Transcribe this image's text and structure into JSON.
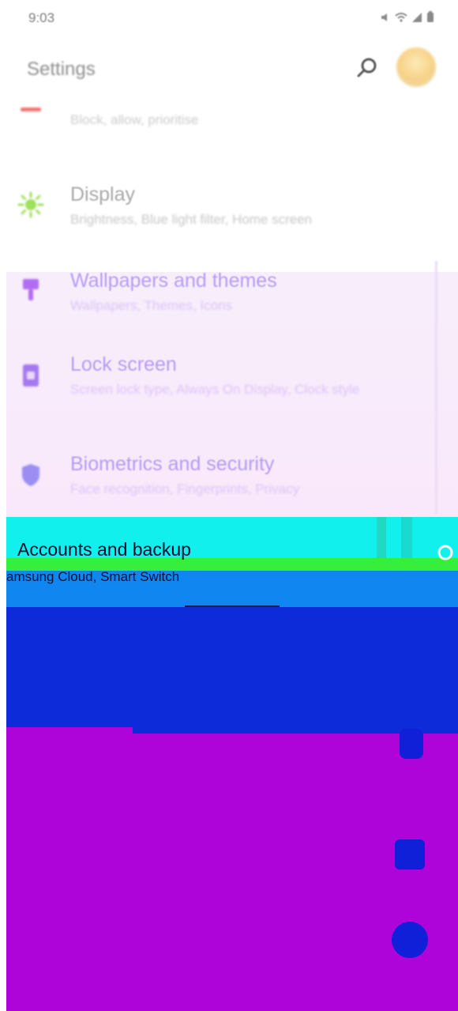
{
  "status_bar": {
    "time": "9:03",
    "icons": [
      "mute-icon",
      "wifi-icon",
      "signal-icon",
      "battery-icon"
    ]
  },
  "header": {
    "title": "Settings",
    "search_icon": "search-icon",
    "avatar_icon": "profile-avatar"
  },
  "settings_items": [
    {
      "title": "",
      "subtitle": "Block, allow, prioritise",
      "icon": "notifications-icon",
      "icon_color": "#f07575"
    },
    {
      "title": "Display",
      "subtitle": "Brightness, Blue light filter, Home screen",
      "icon": "sun-icon",
      "icon_color": "#9fe05a"
    },
    {
      "title": "Wallpapers and themes",
      "subtitle": "Wallpapers, Themes, Icons",
      "icon": "brush-icon",
      "icon_color": "#b06cf2"
    },
    {
      "title": "Lock screen",
      "subtitle": "Screen lock type, Always On Display, Clock style",
      "icon": "lock-screen-icon",
      "icon_color": "#a479f0"
    },
    {
      "title": "Biometrics and security",
      "subtitle": "Face recognition, Fingerprints, Privacy",
      "icon": "shield-icon",
      "icon_color": "#9a8ef3"
    },
    {
      "title": "Accounts and backup",
      "subtitle": "amsung Cloud, Smart Switch",
      "icon": "sync-icon",
      "icon_color": "#ffffff"
    }
  ],
  "colors": {
    "glitch_cyan": "#12f0ee",
    "glitch_green": "#37ee3c",
    "glitch_blue": "#0d2bd8",
    "glitch_purple": "#ae03d9"
  }
}
